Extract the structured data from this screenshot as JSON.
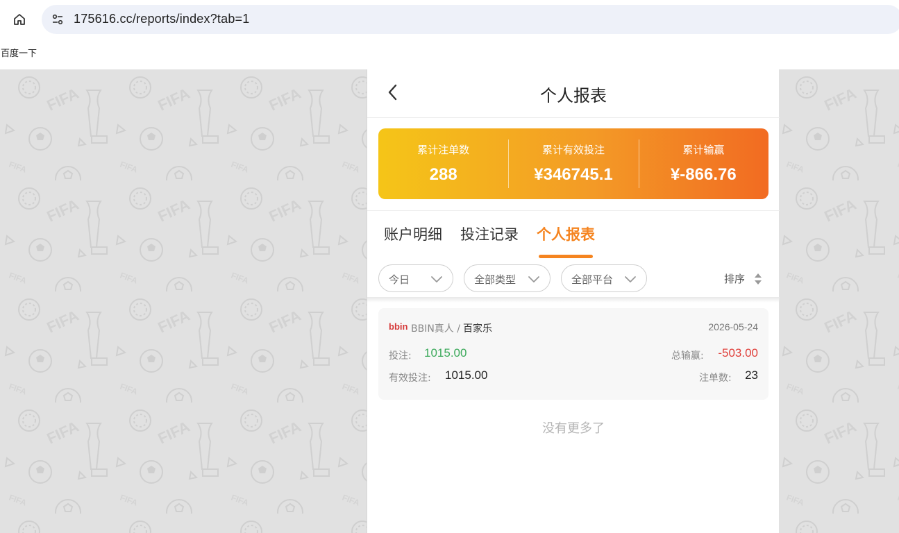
{
  "browser": {
    "url": "175616.cc/reports/index?tab=1",
    "bookmark": "百度一下"
  },
  "header": {
    "title": "个人报表"
  },
  "summary": [
    {
      "label": "累计注单数",
      "value": "288"
    },
    {
      "label": "累计有效投注",
      "value": "¥346745.1"
    },
    {
      "label": "累计输赢",
      "value": "¥-866.76"
    }
  ],
  "tabs": [
    {
      "label": "账户明细",
      "active": false
    },
    {
      "label": "投注记录",
      "active": false
    },
    {
      "label": "个人报表",
      "active": true
    }
  ],
  "filters": {
    "date": "今日",
    "type": "全部类型",
    "platform": "全部平台",
    "sort": "排序"
  },
  "record": {
    "logo_text": "bbin",
    "provider": "BBIN真人",
    "separator": "/",
    "game": "百家乐",
    "date": "2026-05-24",
    "bet_label": "投注:",
    "bet_value": "1015.00",
    "total_label": "总输赢:",
    "total_value": "-503.00",
    "valid_label": "有效投注:",
    "valid_value": "1015.00",
    "count_label": "注单数:",
    "count_value": "23"
  },
  "footer": {
    "no_more": "没有更多了"
  },
  "colors": {
    "accent": "#f5841f",
    "positive": "#3daa5c",
    "negative": "#e0403b"
  }
}
